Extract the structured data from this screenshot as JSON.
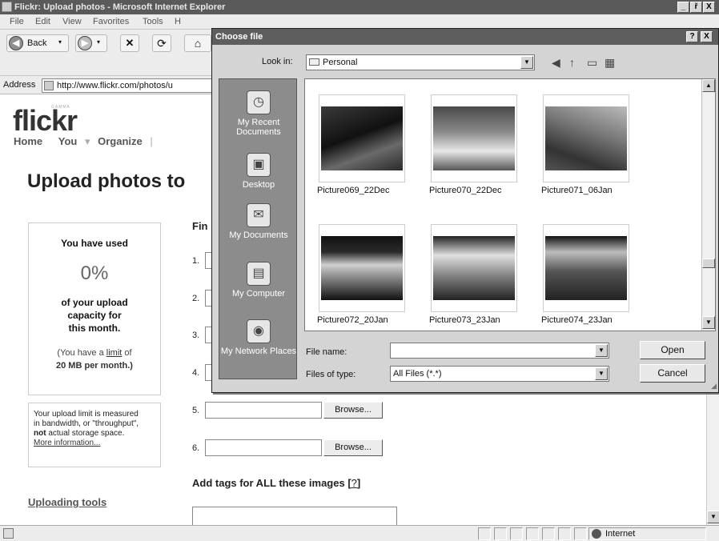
{
  "browser": {
    "title": "Flickr: Upload photos - Microsoft Internet Explorer",
    "menu": [
      "File",
      "Edit",
      "View",
      "Favorites",
      "Tools",
      "H"
    ],
    "back_label": "Back",
    "address_label": "Address",
    "address_value": "http://www.flickr.com/photos/u",
    "status_zone": "Internet",
    "window_buttons": [
      "_",
      "ř",
      "X"
    ]
  },
  "page": {
    "logo": "flickr",
    "logo_sub": "GAMMA",
    "nav": [
      "Home",
      "You",
      "▾",
      "Organize",
      "|"
    ],
    "title": "Upload photos to",
    "find_label": "Fin",
    "usage": {
      "line1": "You have used",
      "percent": "0%",
      "line2": "of your upload",
      "line3": "capacity for",
      "line4": "this month.",
      "limit_line1_pre": "(You have a ",
      "limit_link": "limit",
      "limit_line1_post": " of",
      "limit_line2": "20 MB per month.)"
    },
    "note": {
      "line1": "Your upload limit is measured",
      "line2": "in bandwidth, or \"throughput\",",
      "not": "not",
      "line3_rest": " actual storage space.",
      "more": "More information..."
    },
    "file_rows": [
      "1.",
      "2.",
      "3.",
      "4.",
      "5.",
      "6."
    ],
    "browse_label": "Browse...",
    "tags_label": "Add tags for ALL these images [",
    "tags_help": "?",
    "tags_label_end": "]",
    "uploading_tools": "Uploading tools"
  },
  "dialog": {
    "title": "Choose file",
    "help_btn": "?",
    "close_btn": "X",
    "look_in_label": "Look in:",
    "look_in_value": "Personal",
    "places": [
      "My Recent Documents",
      "Desktop",
      "My Documents",
      "My Computer",
      "My Network Places"
    ],
    "files": [
      "Picture069_22Dec",
      "Picture070_22Dec",
      "Picture071_06Jan",
      "Picture072_20Jan",
      "Picture073_23Jan",
      "Picture074_23Jan"
    ],
    "file_name_label": "File name:",
    "file_name_value": "",
    "files_of_type_label": "Files of type:",
    "files_of_type_value": "All Files (*.*)",
    "open_label": "Open",
    "cancel_label": "Cancel"
  }
}
